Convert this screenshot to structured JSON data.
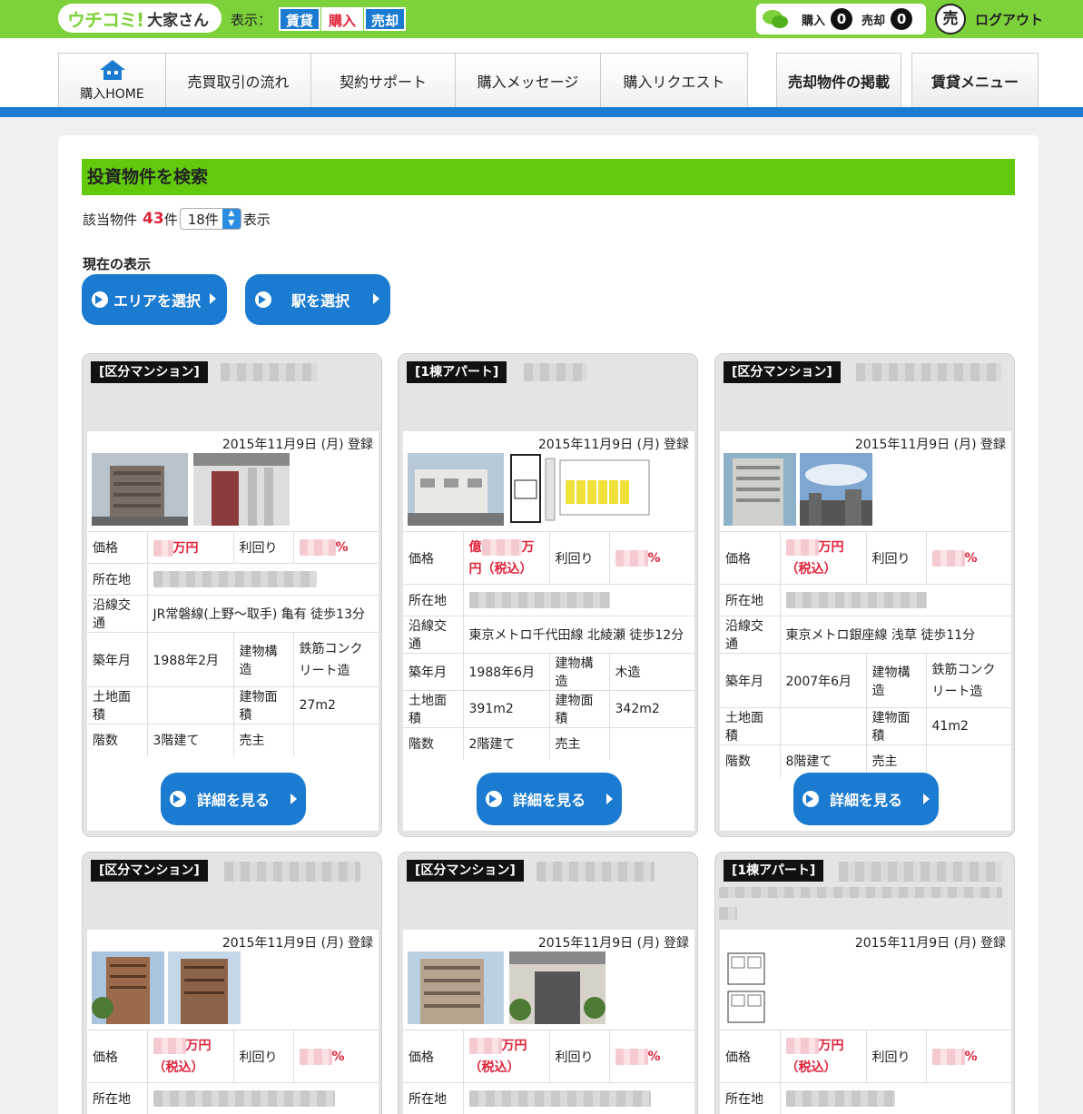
{
  "header": {
    "logo_main": "ウチコミ!",
    "logo_sub": "大家さん",
    "display_label": "表示：",
    "modes": [
      "賃貸",
      "購入",
      "売却"
    ],
    "buy_label": "購入",
    "buy_count": "0",
    "sell_label": "売却",
    "sell_count": "0",
    "sell_icon": "売",
    "logout": "ログアウト"
  },
  "nav": {
    "home": "購入HOME",
    "tabs": [
      "売買取引の流れ",
      "契約サポート",
      "購入メッセージ",
      "購入リクエスト"
    ],
    "right_tabs": [
      "売却物件の掲載",
      "賃貸メニュー"
    ]
  },
  "search": {
    "title": "投資物件を検索",
    "count_prefix": "該当物件",
    "count_value": "43",
    "count_unit": "件",
    "per_page": "18件",
    "per_page_suffix": "表示",
    "current_view": "現在の表示",
    "area_button": "エリアを選択",
    "station_button": "駅を選択"
  },
  "labels": {
    "price": "価格",
    "yield": "利回り",
    "location": "所在地",
    "transit": "沿線交通",
    "built": "築年月",
    "structure": "建物構造",
    "land": "土地面積",
    "building": "建物面積",
    "floors": "階数",
    "seller": "売主",
    "detail": "詳細を見る"
  },
  "listings": [
    {
      "type": "[区分マンション]",
      "date": "2015年11月9日 (月) 登録",
      "price_suffix": "万円",
      "yield_suffix": "%",
      "transit": "JR常磐線(上野～取手) 亀有 徒歩13分",
      "built": "1988年2月",
      "structure": "鉄筋コンクリート造",
      "land": "",
      "building": "27m2",
      "floors": "3階建て",
      "seller": ""
    },
    {
      "type": "[1棟アパート]",
      "date": "2015年11月9日 (月) 登録",
      "price_prefix": "億",
      "price_suffix": "万",
      "price_tax": "円（税込）",
      "yield_suffix": "%",
      "transit": "東京メトロ千代田線 北綾瀬 徒歩12分",
      "built": "1988年6月",
      "structure": "木造",
      "land": "391m2",
      "building": "342m2",
      "floors": "2階建て",
      "seller": ""
    },
    {
      "type": "[区分マンション]",
      "date": "2015年11月9日 (月) 登録",
      "price_suffix": "万円",
      "price_tax": "（税込）",
      "yield_suffix": "%",
      "transit": "東京メトロ銀座線 浅草 徒歩11分",
      "built": "2007年6月",
      "structure": "鉄筋コンクリート造",
      "land": "",
      "building": "41m2",
      "floors": "8階建て",
      "seller": ""
    },
    {
      "type": "[区分マンション]",
      "date": "2015年11月9日 (月) 登録",
      "price_suffix": "万円",
      "price_tax": "（税込）",
      "yield_suffix": "%"
    },
    {
      "type": "[区分マンション]",
      "date": "2015年11月9日 (月) 登録",
      "price_suffix": "万円",
      "price_tax": "（税込）",
      "yield_suffix": "%"
    },
    {
      "type": "[1棟アパート]",
      "date": "2015年11月9日 (月) 登録",
      "price_suffix": "万円",
      "price_tax": "（税込）",
      "yield_suffix": "%"
    }
  ]
}
